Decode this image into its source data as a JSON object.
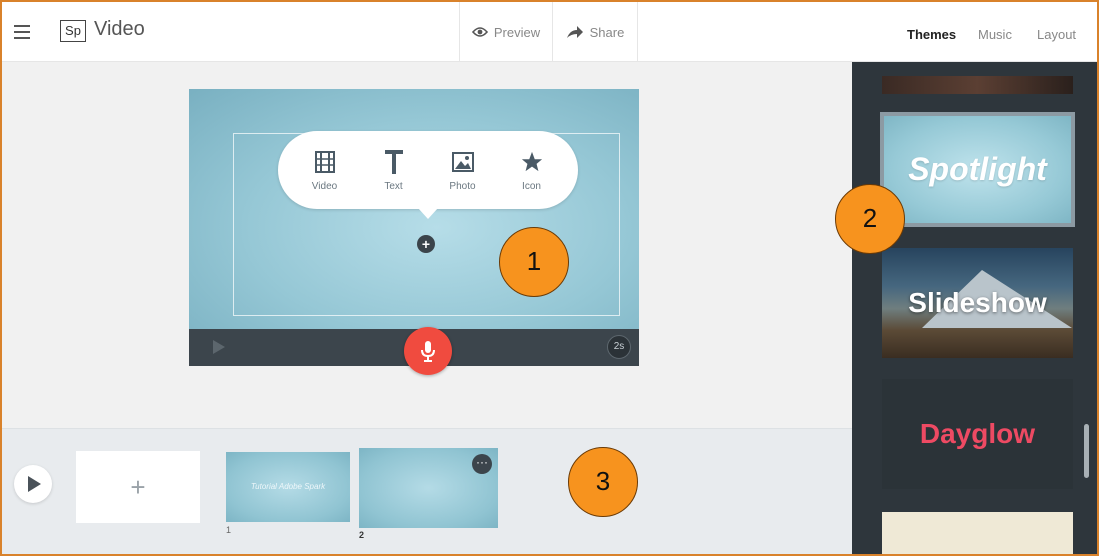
{
  "topbar": {
    "logo": "Sp",
    "title": "Video",
    "preview_label": "Preview",
    "share_label": "Share",
    "tabs": [
      {
        "label": "Themes",
        "active": true
      },
      {
        "label": "Music",
        "active": false
      },
      {
        "label": "Layout",
        "active": false
      }
    ]
  },
  "canvas": {
    "add_menu": [
      {
        "label": "Video",
        "icon": "film-icon"
      },
      {
        "label": "Text",
        "icon": "text-t-icon"
      },
      {
        "label": "Photo",
        "icon": "photo-icon"
      },
      {
        "label": "Icon",
        "icon": "star-icon"
      }
    ],
    "add_symbol": "+",
    "duration": "2s"
  },
  "timeline": {
    "add_symbol": "+",
    "slides": [
      {
        "number": "1",
        "caption": "Tutorial Adobe Spark"
      },
      {
        "number": "2",
        "caption": ""
      }
    ],
    "menu_symbol": "···"
  },
  "themes": {
    "items": [
      "Spotlight",
      "Slideshow",
      "Dayglow"
    ],
    "selected": "Spotlight"
  },
  "annotations": [
    "1",
    "2",
    "3"
  ],
  "colors": {
    "accent_callout": "#f7931e",
    "mic_button": "#f04b3f",
    "panel_bg": "#2e363c",
    "dayglow_text": "#ee4a63"
  }
}
